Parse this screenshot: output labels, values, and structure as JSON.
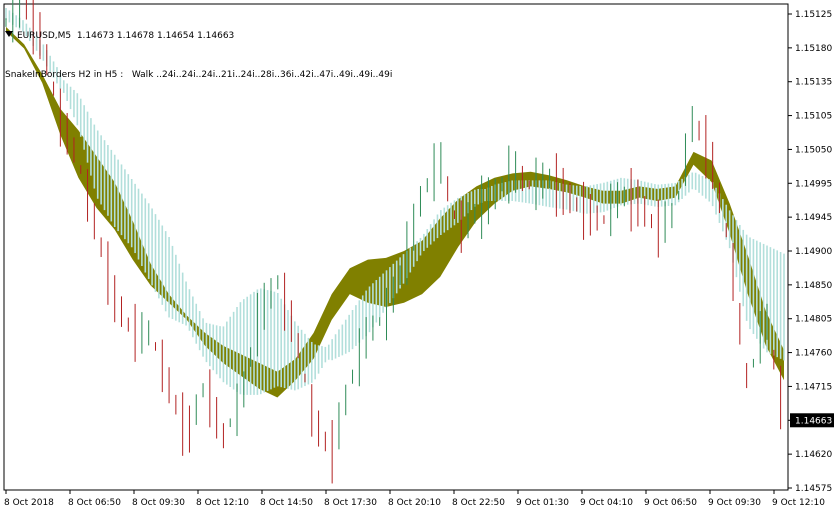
{
  "header": {
    "symbol_line": "EURUSD,M5  1.14673 1.14678 1.14654 1.14663",
    "indicator_line": "SnakeInBorders H2 in H5 :   Walk ..24i..24i..24i..21i..24i..28i..36i..42i..47i..49i..49i..49i"
  },
  "colors": {
    "background": "#ffffff",
    "band": "#808000",
    "bar_fill": "#b2dfdb",
    "bull": "#2e8b57",
    "bear": "#b22222",
    "price_label_bg": "#000000",
    "price_label_text": "#ffffff"
  },
  "chart_data": {
    "type": "line",
    "title": "",
    "x_tick_labels": [
      "8 Oct 2018",
      "8 Oct 06:50",
      "8 Oct 09:30",
      "8 Oct 12:10",
      "8 Oct 14:50",
      "8 Oct 17:30",
      "8 Oct 20:10",
      "8 Oct 22:50",
      "9 Oct 01:30",
      "9 Oct 04:10",
      "9 Oct 06:50",
      "9 Oct 09:30",
      "9 Oct 12:10"
    ],
    "y_tick_labels": [
      "1.15125",
      "1.15180",
      "1.15135",
      "1.15105",
      "1.15050",
      "1.14995",
      "1.14945",
      "1.14900",
      "1.14850",
      "1.14805",
      "1.14760",
      "1.14715",
      "1.14663",
      "1.14620",
      "1.14575"
    ],
    "ylim": [
      1.14575,
      1.15125
    ],
    "current_price": "1.14663",
    "series": [
      {
        "values": [
          1.15105,
          1.15085,
          1.15045,
          1.14985,
          1.14935,
          1.149,
          1.14875,
          1.1484,
          1.1481,
          1.1479,
          1.1477,
          1.1474,
          1.1472,
          1.14705,
          1.1469,
          1.1468,
          1.147,
          1.14725,
          1.1477,
          1.148,
          1.1479,
          1.14785,
          1.1479,
          1.148,
          1.1482,
          1.14855,
          1.14885,
          1.14905,
          1.1492,
          1.14925,
          1.14922,
          1.14918,
          1.14912,
          1.14905,
          1.14905,
          1.14912,
          1.14908,
          1.14912,
          1.1495,
          1.1493,
          1.1487,
          1.148,
          1.1474,
          1.147
        ]
      },
      {
        "values": [
          1.1511,
          1.1509,
          1.15055,
          1.15015,
          1.1499,
          1.1496,
          1.1493,
          1.14885,
          1.14835,
          1.148,
          1.14775,
          1.14755,
          1.1474,
          1.1473,
          1.1472,
          1.1471,
          1.14725,
          1.14755,
          1.148,
          1.1483,
          1.1484,
          1.14842,
          1.1485,
          1.14862,
          1.14888,
          1.1491,
          1.14925,
          1.14935,
          1.1494,
          1.14942,
          1.14938,
          1.14932,
          1.14925,
          1.1492,
          1.1492,
          1.14925,
          1.14922,
          1.14925,
          1.14965,
          1.14955,
          1.14905,
          1.14845,
          1.1478,
          1.14735
        ]
      },
      {
        "values": [
          1.15125,
          1.1511,
          1.1508,
          1.15045,
          1.15025,
          1.14985,
          1.14955,
          1.14925,
          1.14895,
          1.1486,
          1.14805,
          1.1476,
          1.14755,
          1.14785,
          1.148,
          1.14795,
          1.1476,
          1.14735,
          1.1473,
          1.1474,
          1.1476,
          1.1479,
          1.1482,
          1.14855,
          1.14875,
          1.1489,
          1.1491,
          1.1492,
          1.14925,
          1.14925,
          1.14925,
          1.1492,
          1.14918,
          1.14922,
          1.14928,
          1.14925,
          1.1492,
          1.14922,
          1.14935,
          1.14925,
          1.1489,
          1.1486,
          1.1485,
          1.1484
        ]
      },
      {
        "values": [
          1.15125,
          1.1511,
          1.15085,
          1.1505,
          1.15,
          1.1492,
          1.14885,
          1.1486,
          1.1482,
          1.1478,
          1.1477,
          1.1473,
          1.14705,
          1.1469,
          1.1469,
          1.147,
          1.14695,
          1.14705,
          1.1474,
          1.1477,
          1.148,
          1.1482,
          1.1484,
          1.1486,
          1.1489,
          1.14905,
          1.14915,
          1.14915,
          1.14915,
          1.14912,
          1.14908,
          1.14905,
          1.149,
          1.14902,
          1.1491,
          1.14912,
          1.14908,
          1.1491,
          1.1493,
          1.14912,
          1.1486,
          1.1477,
          1.1474,
          1.1473
        ]
      },
      {
        "values": [
          1.1512,
          1.1514,
          1.151,
          1.1501,
          1.1496,
          1.1488,
          1.148,
          1.1476,
          1.1476,
          1.147,
          1.1464,
          1.147,
          1.1464,
          1.1468,
          1.1478,
          1.1482,
          1.1476,
          1.1466,
          1.1462,
          1.147,
          1.1476,
          1.1478,
          1.1484,
          1.1492,
          1.1496,
          1.1488,
          1.149,
          1.1492,
          1.1495,
          1.1493,
          1.1494,
          1.1492,
          1.149,
          1.1489,
          1.1492,
          1.1491,
          1.1488,
          1.149,
          1.1501,
          1.1496,
          1.1486,
          1.147,
          1.1478,
          1.14663
        ]
      }
    ]
  }
}
